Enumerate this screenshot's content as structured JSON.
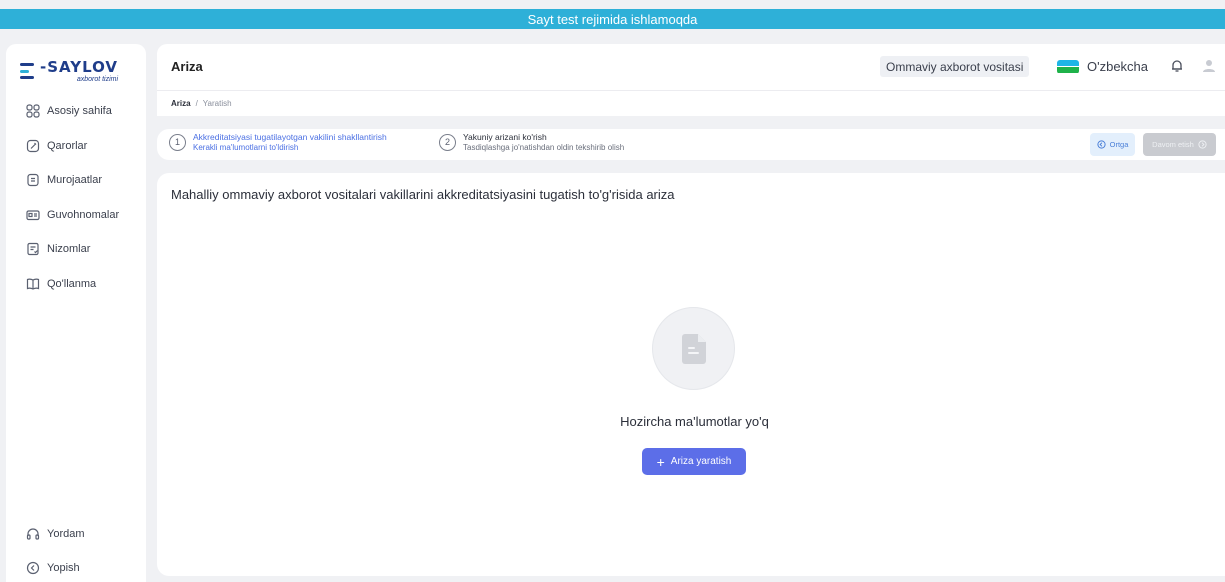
{
  "banner": {
    "text": "Sayt test rejimida ishlamoqda"
  },
  "logo": {
    "title": "-SAYLOV",
    "subtitle": "axborot tizimi"
  },
  "sidebar": {
    "items": [
      {
        "label": "Asosiy sahifa",
        "icon": "grid-icon"
      },
      {
        "label": "Qarorlar",
        "icon": "edit-icon"
      },
      {
        "label": "Murojaatlar",
        "icon": "document-icon"
      },
      {
        "label": "Guvohnomalar",
        "icon": "id-card-icon"
      },
      {
        "label": "Nizomlar",
        "icon": "clipboard-icon"
      },
      {
        "label": "Qo'llanma",
        "icon": "book-icon"
      }
    ],
    "bottom": [
      {
        "label": "Yordam",
        "icon": "headphones-icon"
      },
      {
        "label": "Yopish",
        "icon": "collapse-icon"
      }
    ]
  },
  "header": {
    "title": "Ariza",
    "media_chip": "Ommaviy axborot vositasi",
    "language": "O'zbekcha"
  },
  "breadcrumb": {
    "current": "Ariza",
    "separator": "/",
    "next": "Yaratish"
  },
  "stepper": {
    "steps": [
      {
        "num": "1",
        "title": "Akkreditatsiyasi tugatilayotgan vakilini shakllantirish",
        "sub": "Kerakli ma'lumotlarni to'ldirish"
      },
      {
        "num": "2",
        "title": "Yakuniy arizani ko'rish",
        "sub": "Tasdiqlashga jo'natishdan oldin tekshirib olish"
      }
    ],
    "back_label": "Ortga",
    "next_label": "Davom etish"
  },
  "main": {
    "title": "Mahalliy ommaviy axborot vositalari vakillarini akkreditatsiyasini tugatish to'g'risida ariza",
    "empty_text": "Hozircha ma'lumotlar yo'q",
    "create_label": "Ariza yaratish"
  },
  "colors": {
    "banner": "#2eb0d8",
    "accent": "#5c6ee8",
    "brand": "#1f3d8a"
  }
}
